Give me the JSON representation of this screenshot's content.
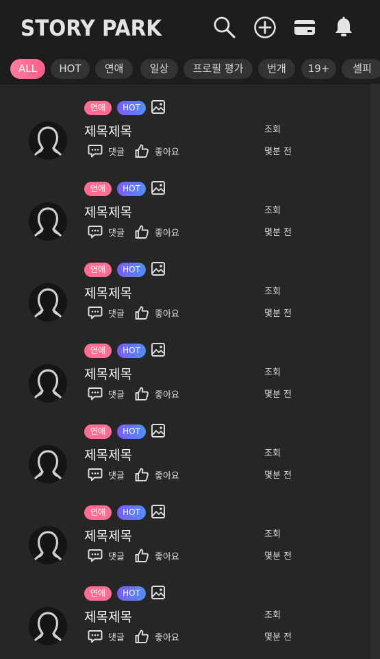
{
  "app": {
    "title": "STORY PARK"
  },
  "header_icons": [
    "search-icon",
    "add-circle-icon",
    "wallet-icon",
    "bell-icon"
  ],
  "categories": [
    "ALL",
    "HOT",
    "연애",
    "일상",
    "프로필 평가",
    "번개",
    "19+",
    "셀피"
  ],
  "active_category": "ALL",
  "colors": {
    "accent": "#ff6e92",
    "hot_start": "#7b5cf0",
    "hot_end": "#4f8ff5",
    "background": "#262626",
    "header": "#1d1d1d"
  },
  "posts": [
    {
      "category": "연애",
      "hot": "HOT",
      "title": "제목제목",
      "views": "조회",
      "comments": "댓글",
      "likes": "좋아요",
      "time": "몇분 전"
    },
    {
      "category": "연애",
      "hot": "HOT",
      "title": "제목제목",
      "views": "조회",
      "comments": "댓글",
      "likes": "좋아요",
      "time": "몇분 전"
    },
    {
      "category": "연애",
      "hot": "HOT",
      "title": "제목제목",
      "views": "조회",
      "comments": "댓글",
      "likes": "좋아요",
      "time": "몇분 전"
    },
    {
      "category": "연애",
      "hot": "HOT",
      "title": "제목제목",
      "views": "조회",
      "comments": "댓글",
      "likes": "좋아요",
      "time": "몇분 전"
    },
    {
      "category": "연애",
      "hot": "HOT",
      "title": "제목제목",
      "views": "조회",
      "comments": "댓글",
      "likes": "좋아요",
      "time": "몇분 전"
    },
    {
      "category": "연애",
      "hot": "HOT",
      "title": "제목제목",
      "views": "조회",
      "comments": "댓글",
      "likes": "좋아요",
      "time": "몇분 전"
    },
    {
      "category": "연애",
      "hot": "HOT",
      "title": "제목제목",
      "views": "조회",
      "comments": "댓글",
      "likes": "좋아요",
      "time": "몇분 전"
    }
  ]
}
